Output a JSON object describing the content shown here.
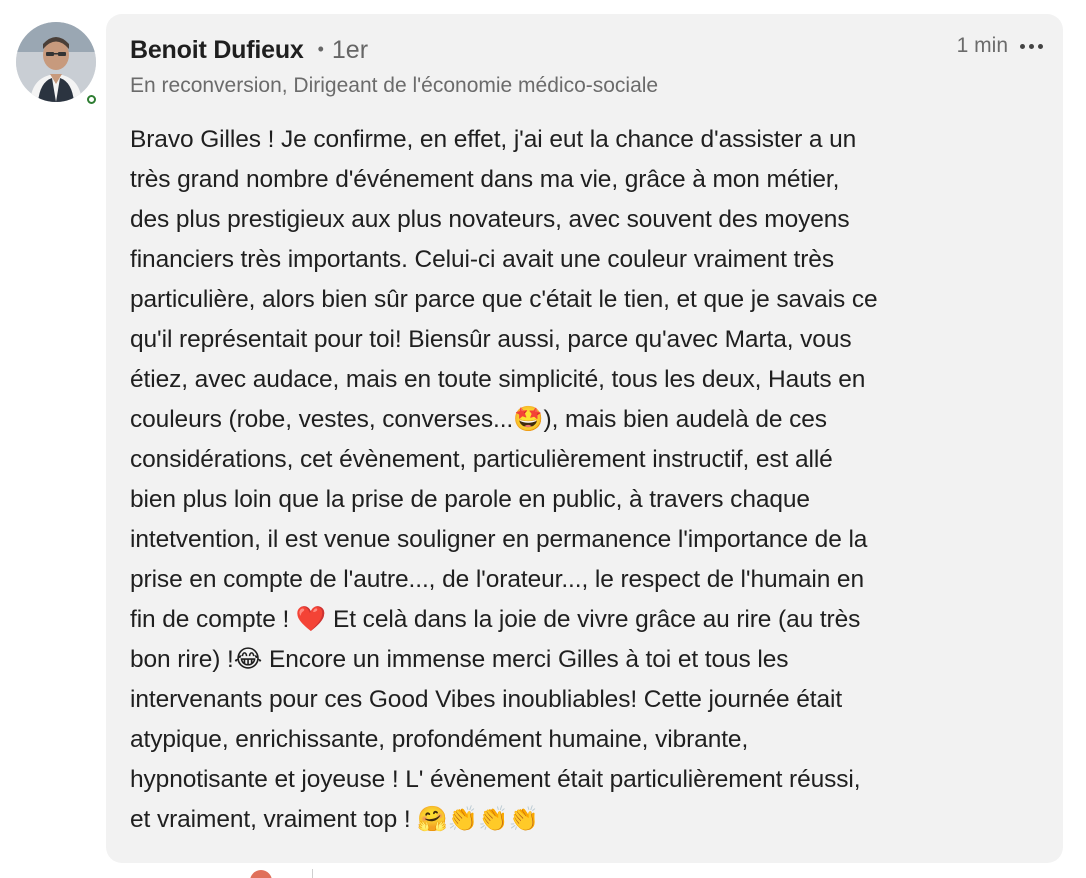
{
  "comment": {
    "author": {
      "name": "Benoit Dufieux",
      "degree": "1er",
      "headline": "En reconversion, Dirigeant de l'économie médico-sociale",
      "avatar_icon": "profile-photo",
      "presence_color": "#2e7d32"
    },
    "timestamp": "1 min",
    "more_icon": "ellipsis-icon",
    "text": "Bravo Gilles ! Je confirme, en effet, j'ai eut la chance d'assister a un\ntrès grand nombre d'événement dans ma vie, grâce à mon métier,\ndes plus prestigieux aux plus novateurs, avec souvent des moyens\nfinanciers très importants. Celui-ci avait une couleur vraiment très\nparticulière, alors bien sûr parce que c'était le tien, et que je savais ce\nqu'il représentait pour toi! Biensûr aussi, parce qu'avec Marta, vous\nétiez, avec audace, mais en toute simplicité, tous les deux, Hauts en\ncouleurs (robe, vestes, converses...🤩), mais bien audelà de ces\nconsidérations, cet évènement, particulièrement instructif, est allé\nbien plus loin que la prise de parole en public, à travers chaque\nintetvention, il est venue souligner en permanence l'importance de la\nprise en compte de l'autre..., de l'orateur..., le respect de l'humain en\nfin de compte ! ❤️ Et celà dans la joie de vivre grâce au rire (au très\nbon rire) !😂 Encore un immense merci Gilles à toi et tous les\nintervenants pour ces Good Vibes inoubliables! Cette journée était\natypique, enrichissante, profondément humaine, vibrante,\nhypnotisante et joyeuse ! L' évènement était particulièrement réussi,\net vraiment, vraiment top ! 🤗👏👏👏",
    "bubble_color": "#f2f2f2"
  }
}
